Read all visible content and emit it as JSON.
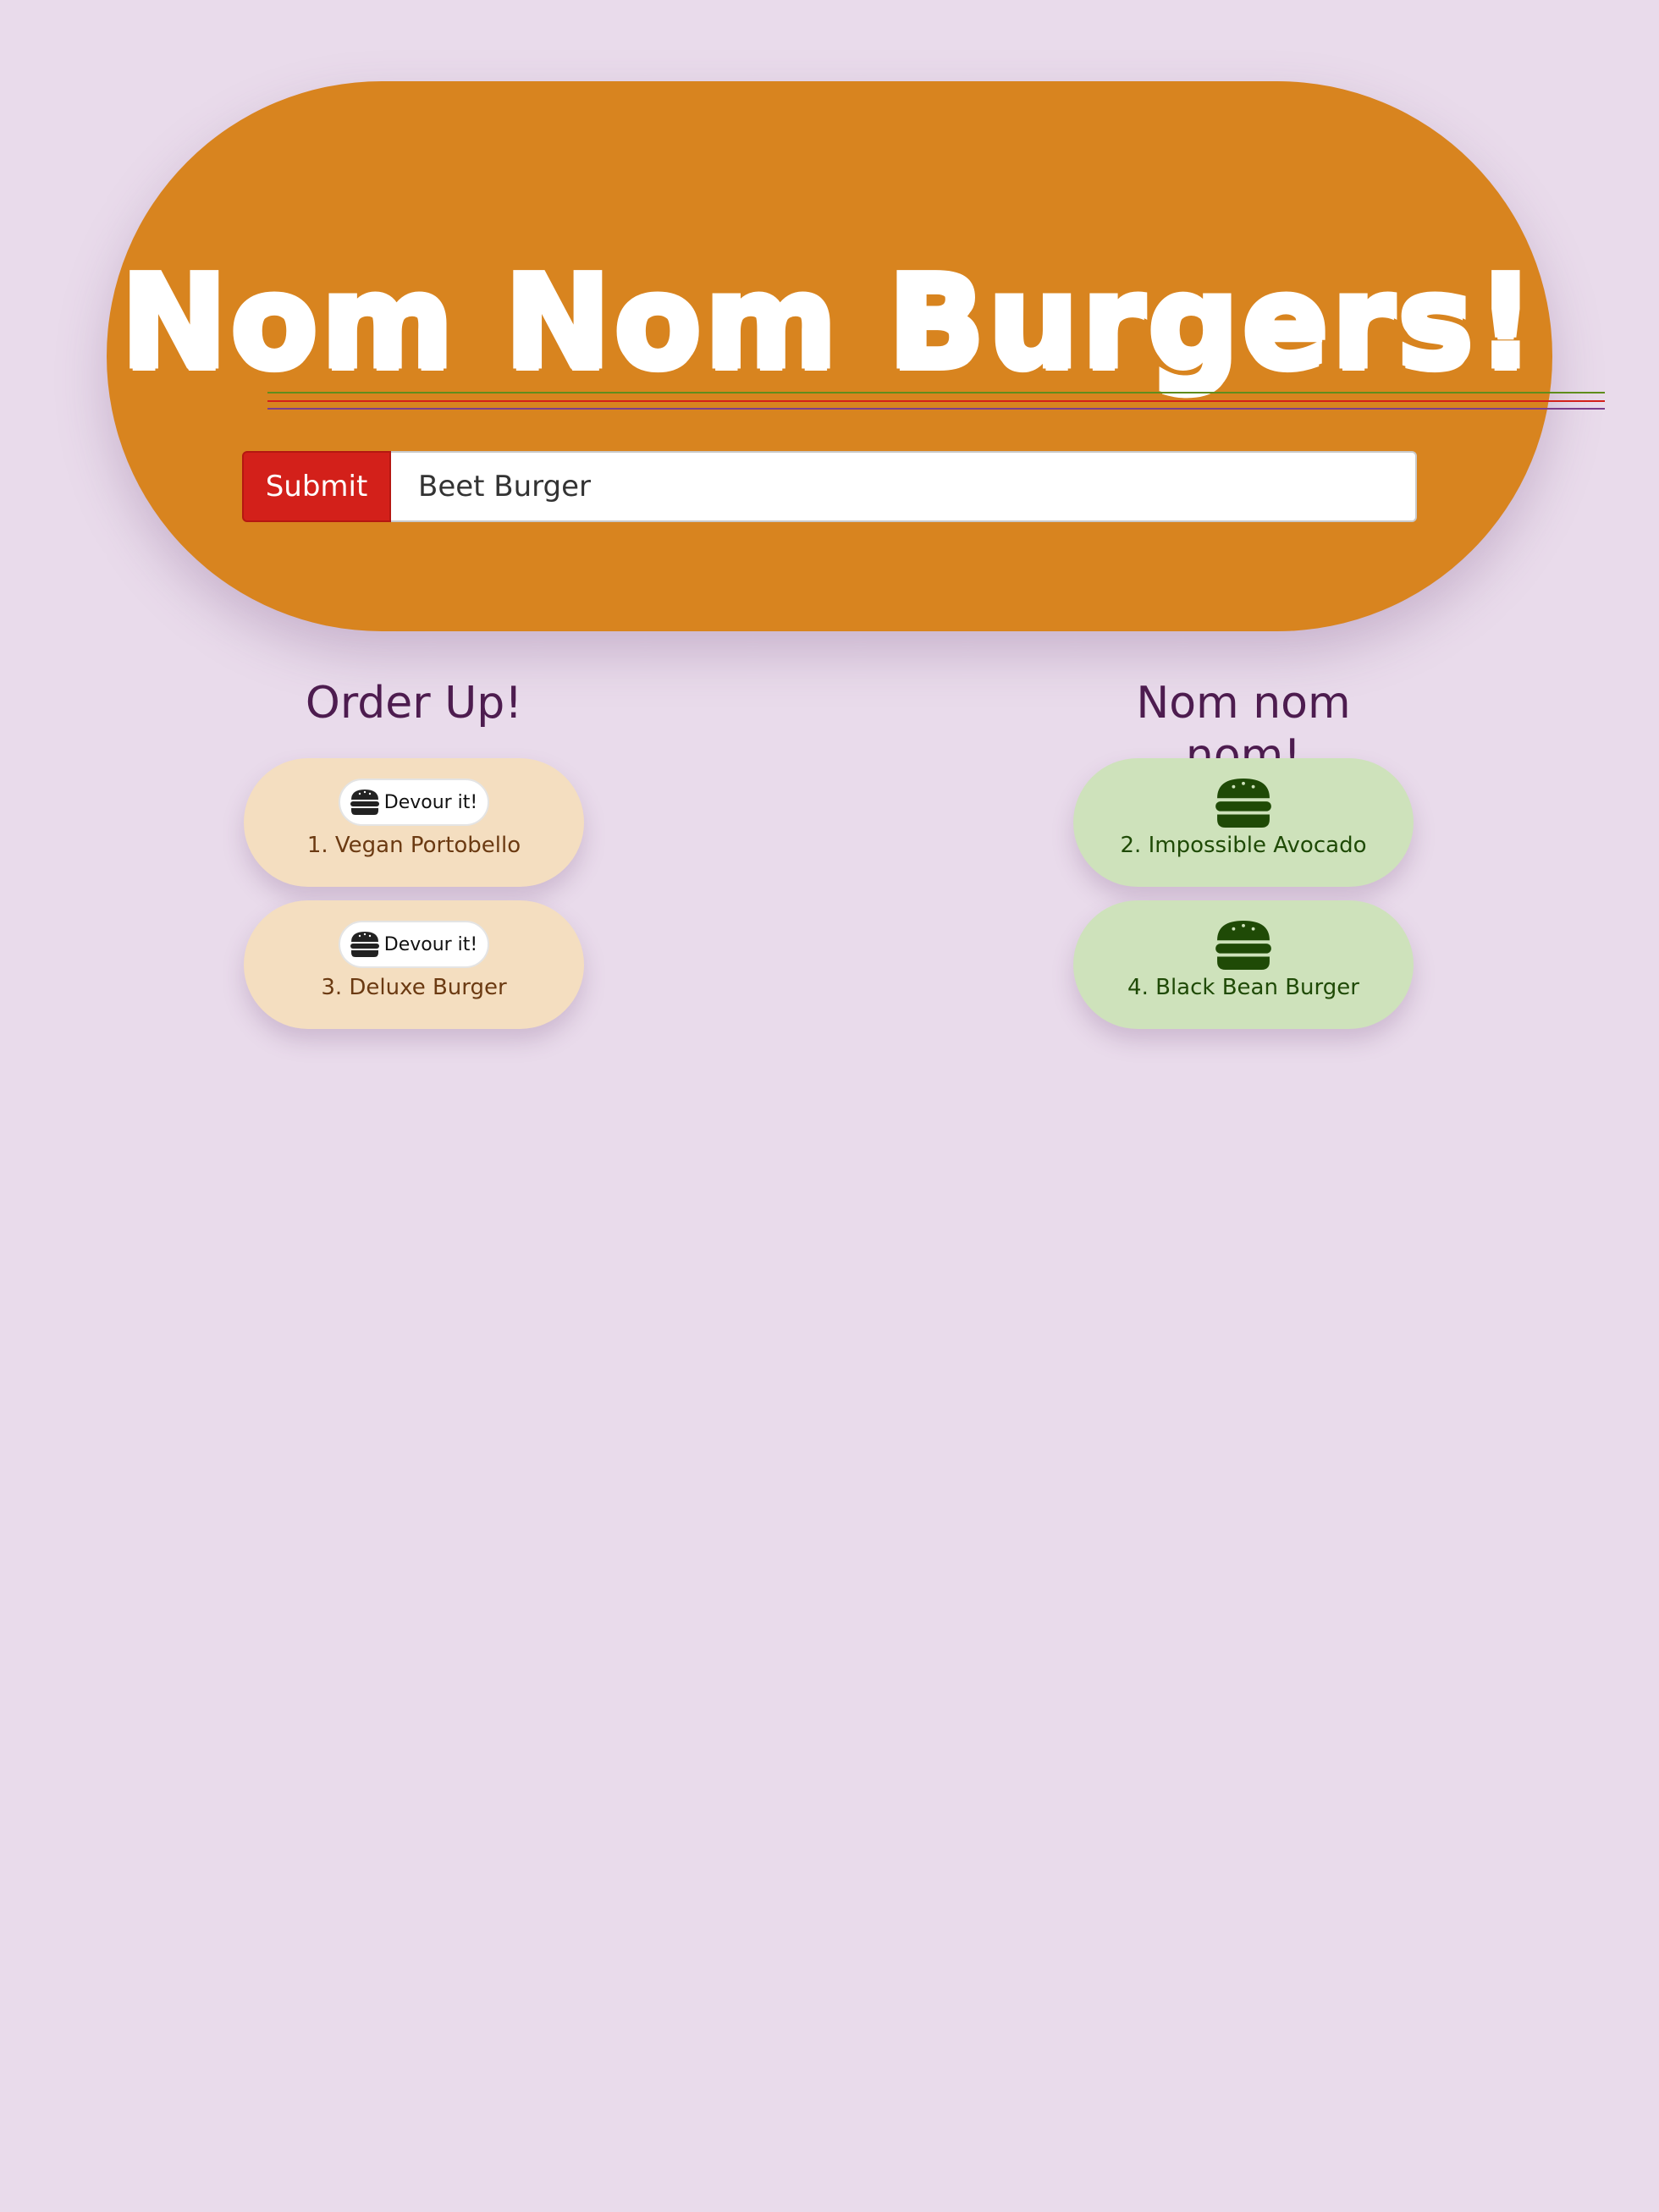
{
  "header": {
    "title": "Nom Nom Burgers!",
    "stripe_colors": [
      "#5f8d1c",
      "#d3201a",
      "#7a3e8d"
    ]
  },
  "form": {
    "submit_label": "Submit",
    "input_value": "Beet Burger"
  },
  "colors": {
    "page_background": "#e9dbeb",
    "header_background": "#d8841f",
    "submit_button": "#d3201a",
    "heading_text": "#4d1c4f",
    "order_pill": "#f4dec0",
    "eaten_pill": "#cee2bb"
  },
  "order_up": {
    "heading": "Order Up!",
    "items": [
      {
        "label": "1. Vegan Portobello",
        "button_label": "Devour it!",
        "button_icon": "burger-icon"
      },
      {
        "label": "3. Deluxe Burger",
        "button_label": "Devour it!",
        "button_icon": "burger-icon"
      }
    ]
  },
  "eaten": {
    "heading": "Nom nom nom!",
    "items": [
      {
        "label": "2. Impossible Avocado",
        "icon": "burger-icon"
      },
      {
        "label": "4. Black Bean Burger",
        "icon": "burger-icon"
      }
    ]
  }
}
